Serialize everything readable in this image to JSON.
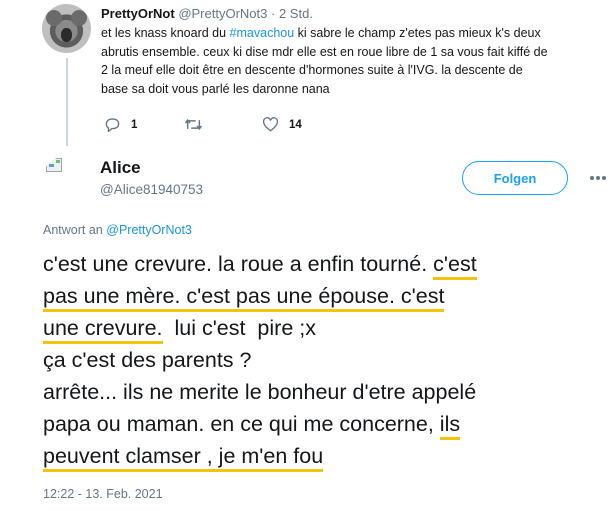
{
  "reply_tweet": {
    "display_name": "PrettyOrNot",
    "handle": "@PrettyOrNot3",
    "separator": "·",
    "time": "2 Std.",
    "text_lines": [
      [
        "et les knass knoard du ",
        "#mavachou",
        " ki sabre le champ z'etes pas mieux k's deux"
      ],
      [
        "abrutis ensemble. ceux ki dise mdr elle est en roue libre de 1 sa vous fait kiffé de"
      ],
      [
        "2 la meuf elle doit être en descente d'hormones suite à l'IVG. la descente de"
      ],
      [
        "base sa doit vous parlé les daronne nana"
      ]
    ],
    "hashtag": "#mavachou",
    "reply_count": "1",
    "retweet_count": "",
    "like_count": "14"
  },
  "main_tweet": {
    "display_name": "Alice",
    "handle": "@Alice81940753",
    "follow_label": "Folgen",
    "reply_prefix": "Antwort an",
    "reply_to": "@PrettyOrNot3",
    "lines": [
      {
        "plain": "c'est une crevure. la roue a enfin tourné. ",
        "highlight": "c'est"
      },
      {
        "plain": "",
        "highlight": "pas une mère. c'est pas une épouse. c'est"
      },
      {
        "plain": "",
        "highlight": "une crevure.",
        "after": "  lui c'est  pire ;x"
      },
      {
        "plain": "ça c'est des parents ?",
        "highlight": ""
      },
      {
        "plain": "arrête... ils ne merite le bonheur d'etre appelé",
        "highlight": ""
      },
      {
        "plain": "papa ou maman. en ce qui me concerne, ",
        "highlight": "ils"
      },
      {
        "plain": "",
        "highlight": "peuvent clamser , je m'en fou"
      }
    ],
    "timestamp": "12:22 - 13. Feb. 2021"
  },
  "colors": {
    "accent": "#1da1f2",
    "link": "#1b95e0",
    "muted": "#657786",
    "highlight": "#f2c40e"
  }
}
